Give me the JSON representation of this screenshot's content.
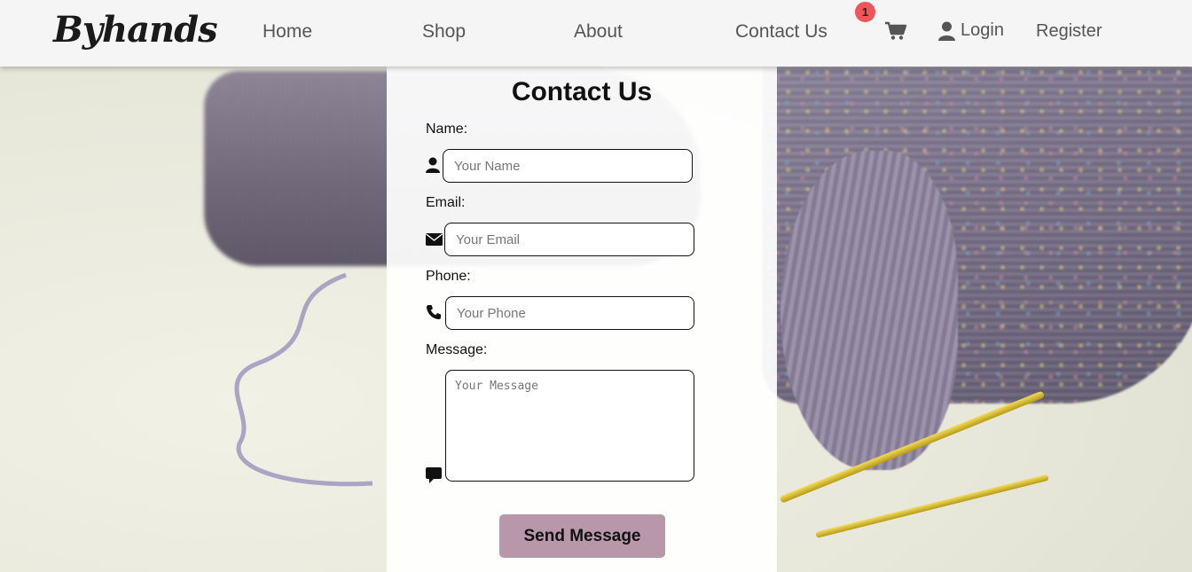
{
  "brand": {
    "logo": "Byhands"
  },
  "nav": {
    "home": "Home",
    "shop": "Shop",
    "about": "About",
    "contact": "Contact Us",
    "cart_count": "1",
    "login": "Login",
    "register": "Register"
  },
  "icons": {
    "cart": "cart-icon",
    "user": "user-icon",
    "name": "user-icon",
    "email": "envelope-icon",
    "phone": "phone-icon",
    "message": "comment-icon"
  },
  "form": {
    "title": "Contact Us",
    "name_label": "Name:",
    "name_placeholder": "Your Name",
    "email_label": "Email:",
    "email_placeholder": "Your Email",
    "phone_label": "Phone:",
    "phone_placeholder": "Your Phone",
    "message_label": "Message:",
    "message_placeholder": "Your Message",
    "submit_label": "Send Message"
  },
  "colors": {
    "button": "#b897ab",
    "badge": "#f0555a",
    "header_bg": "#f5f5f5"
  }
}
